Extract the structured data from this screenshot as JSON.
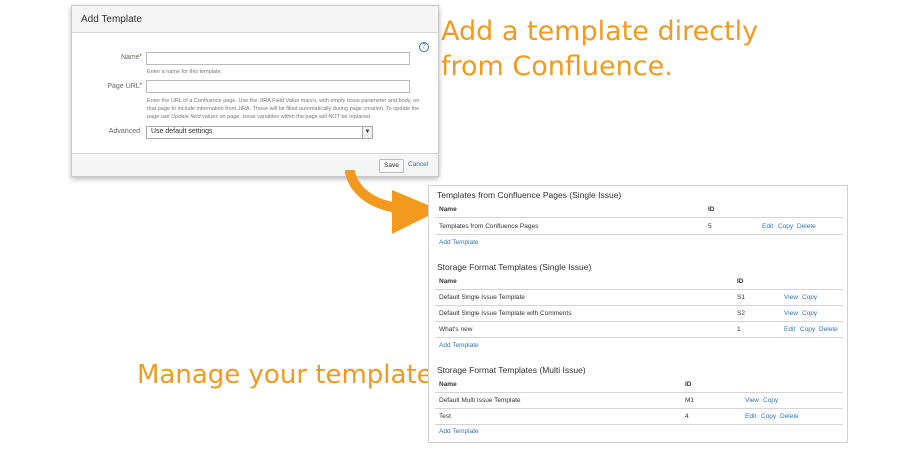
{
  "dialog": {
    "title": "Add Template",
    "help_icon": "?",
    "name_label": "Name",
    "name_value": "",
    "name_description": "Enter a name for this template.",
    "page_url_label": "Page URL",
    "page_url_value": "",
    "page_url_description_1": "Enter the URL of a Confluence page. Use the JIRA Field Value macro, with empty issue parameter and body, on",
    "page_url_description_2": "that page to include information from JIRA. These will be filled automatically during page creation. To update the",
    "page_url_description_3a": "page use ",
    "page_url_description_3b": "Update field values on page",
    "page_url_description_3c": ". Issue variables within the page will NOT be replaced.",
    "advanced_label": "Advanced",
    "advanced_value": "Use default settings",
    "save_label": "Save",
    "cancel_label": "Cancel",
    "required_marker": "*"
  },
  "captions": {
    "top_line1": "Add a template directly",
    "top_line2": "from Confluence.",
    "bottom": "Manage your templates."
  },
  "panel": {
    "sections": [
      {
        "title": "Templates from Confluence Pages (Single Issue)",
        "col_name": "Name",
        "col_id": "ID",
        "rows": [
          {
            "name": "Templates from Confluence Pages",
            "id": "5",
            "actions": [
              "Edit",
              "Copy",
              "Delete"
            ]
          }
        ],
        "add_label": "Add Template"
      },
      {
        "title": "Storage Format Templates (Single Issue)",
        "col_name": "Name",
        "col_id": "ID",
        "rows": [
          {
            "name": "Default Single Issue Template",
            "id": "S1",
            "actions": [
              "View",
              "Copy"
            ]
          },
          {
            "name": "Default Single Issue Template with Comments",
            "id": "S2",
            "actions": [
              "View",
              "Copy"
            ]
          },
          {
            "name": "What's new",
            "id": "1",
            "actions": [
              "Edit",
              "Copy",
              "Delete"
            ]
          }
        ],
        "add_label": "Add Template"
      },
      {
        "title": "Storage Format Templates (Multi Issue)",
        "col_name": "Name",
        "col_id": "ID",
        "rows": [
          {
            "name": "Default Multi Issue Template",
            "id": "M1",
            "actions": [
              "View",
              "Copy"
            ]
          },
          {
            "name": "Test",
            "id": "4",
            "actions": [
              "Edit",
              "Copy",
              "Delete"
            ]
          }
        ],
        "add_label": "Add Template"
      }
    ]
  },
  "colors": {
    "accent_orange": "#f39a1e",
    "link_blue": "#3572b0"
  },
  "icons": {
    "help": "help-icon",
    "select_arrow": "chevron-down-icon",
    "arrow": "curved-arrow-icon"
  }
}
